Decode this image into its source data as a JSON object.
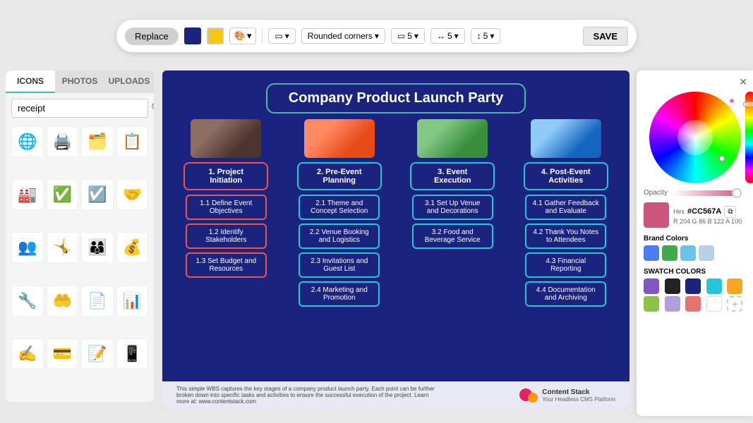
{
  "toolbar": {
    "replace_label": "Replace",
    "rounded_corners_label": "Rounded corners",
    "save_label": "SAVE",
    "number1": "5",
    "number2": "5",
    "number3": "5"
  },
  "left_panel": {
    "tabs": [
      "ICONS",
      "PHOTOS",
      "UPLOADS"
    ],
    "active_tab": "ICONS",
    "search_placeholder": "receipt",
    "icons": [
      "🌐",
      "🖨",
      "🗂",
      "📋",
      "🏭",
      "✅",
      "☑",
      "🤝",
      "👥",
      "🤸",
      "👨‍👩‍👦",
      "💰",
      "🔧",
      "🤲",
      "📄",
      "📊",
      "✍",
      "💳",
      "📝",
      "📱"
    ]
  },
  "canvas": {
    "title": "Company Product Launch Party",
    "columns": [
      {
        "id": "col1",
        "header": "1. Project\nInitiation",
        "border_color": "red",
        "sub_items": [
          "1.1 Define Event\nObjectives",
          "1.2 Identify\nStakeholders",
          "1.3 Set Budget and\nResources"
        ]
      },
      {
        "id": "col2",
        "header": "2. Pre-Event\nPlanning",
        "border_color": "cyan",
        "sub_items": [
          "2.1 Theme and\nConcept Selection",
          "2.2 Venue Booking\nand Logistics",
          "2.3 Invitations and\nGuest List",
          "2.4 Marketing and\nPromotion"
        ]
      },
      {
        "id": "col3",
        "header": "3. Event\nExecution",
        "border_color": "cyan",
        "sub_items": [
          "3.1 Set Up Venue\nand Decorations",
          "3.2 Food and\nBeverage Service"
        ]
      },
      {
        "id": "col4",
        "header": "4. Post-Event\nActivities",
        "border_color": "cyan",
        "sub_items": [
          "4.1 Gather Feedback\nand Evaluate",
          "4.2 Thank You Notes\nto Attendees",
          "4.3 Financial\nReporting",
          "4.4 Documentation\nand Archiving"
        ]
      }
    ],
    "footer_text": "This simple WBS captures the key stages of a company product launch party. Each point can be further broken down into specific tasks and activities to ensure the successful execution of the project. Learn more at: www.contentstack.com",
    "logo_name": "Content Stack",
    "logo_subtitle": "Your Headless CMS Platform"
  },
  "right_panel": {
    "opacity_label": "Opacity",
    "hex_label": "Hex",
    "hex_value": "#CC567A",
    "rgb_r": "204",
    "rgb_g": "86",
    "rgb_b": "122",
    "rgb_a": "100",
    "brand_colors_label": "Brand Colors",
    "brand_colors": [
      "#4c7cf3",
      "#43a84a",
      "#6bc4e8",
      "#b8cfe8"
    ],
    "swatch_colors_label": "SWATCH COLORS",
    "swatches": [
      "#7e57c2",
      "#222222",
      "#1a237e",
      "#26c6da",
      "#f5a623",
      "#8bc34a",
      "#b39ddb",
      "#e57373",
      "#ffffff"
    ]
  }
}
